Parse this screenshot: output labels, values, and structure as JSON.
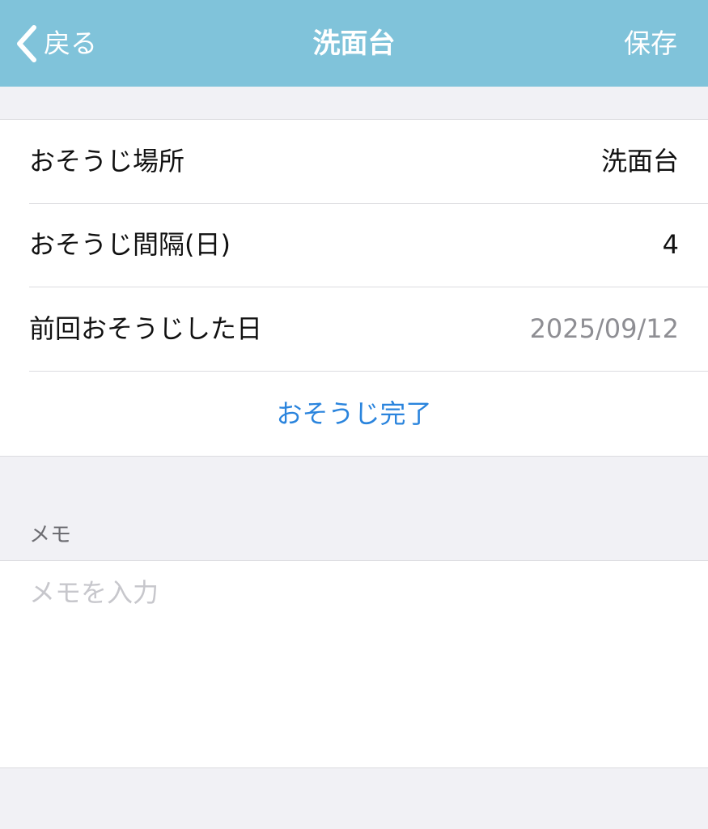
{
  "nav": {
    "back_label": "戻る",
    "title": "洗面台",
    "save_label": "保存"
  },
  "settings": {
    "location": {
      "label": "おそうじ場所",
      "value": "洗面台"
    },
    "interval": {
      "label": "おそうじ間隔(日)",
      "value": "4"
    },
    "last_cleaned": {
      "label": "前回おそうじした日",
      "value": "2025/09/12"
    },
    "complete_label": "おそうじ完了"
  },
  "memo": {
    "header": "メモ",
    "placeholder": "メモを入力",
    "value": ""
  },
  "colors": {
    "navbar": "#80c3da",
    "accent": "#2a84dd",
    "background": "#f1f1f5",
    "muted_text": "#8e8e93"
  },
  "icons": {
    "back": "chevron-left-icon"
  }
}
